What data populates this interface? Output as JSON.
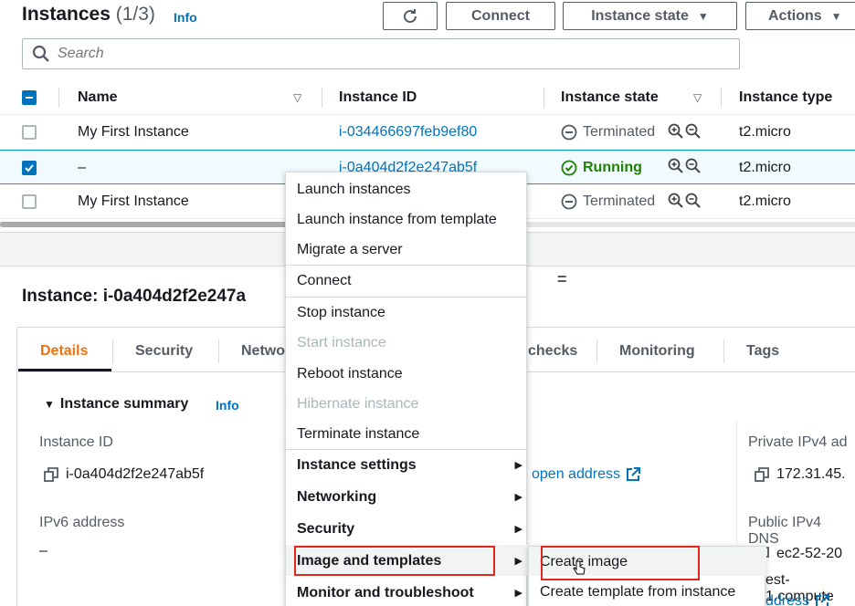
{
  "header": {
    "title": "Instances",
    "count": "(1/3)",
    "info": "Info",
    "connect": "Connect",
    "instance_state": "Instance state",
    "actions": "Actions"
  },
  "search": {
    "placeholder": "Search"
  },
  "table": {
    "columns": [
      "Name",
      "Instance ID",
      "Instance state",
      "Instance type"
    ],
    "rows": [
      {
        "name": "My First Instance",
        "id": "i-034466697feb9ef80",
        "state": "Terminated",
        "type": "t2.micro",
        "selected": false
      },
      {
        "name": "–",
        "id": "i-0a404d2f2e247ab5f",
        "state": "Running",
        "type": "t2.micro",
        "selected": true
      },
      {
        "name": "My First Instance",
        "id": "",
        "state": "Terminated",
        "type": "t2.micro",
        "selected": false
      }
    ]
  },
  "details": {
    "title": "Instance: i-0a404d2f2e247a",
    "tabs": [
      "Details",
      "Security",
      "Netwo",
      "checks",
      "Monitoring",
      "Tags"
    ],
    "summary": "Instance summary",
    "summary_info": "Info",
    "instance_id_label": "Instance ID",
    "instance_id_value": "i-0a404d2f2e247ab5f",
    "ipv6_label": "IPv6 address",
    "ipv6_value": "–",
    "open_address": "open address",
    "private_ipv4_label": "Private IPv4 ad",
    "private_ipv4_value": "172.31.45.",
    "public_dns_label": "Public IPv4 DNS",
    "public_dns_value": "ec2-52-20",
    "public_dns_value2": "est-1.compute",
    "address_link": "ddress"
  },
  "context_menu": {
    "items": [
      {
        "label": "Launch instances"
      },
      {
        "label": "Launch instance from template"
      },
      {
        "label": "Migrate a server"
      },
      {
        "label": "Connect"
      },
      {
        "label": "Stop instance"
      },
      {
        "label": "Start instance"
      },
      {
        "label": "Reboot instance"
      },
      {
        "label": "Hibernate instance"
      },
      {
        "label": "Terminate instance"
      },
      {
        "label": "Instance settings"
      },
      {
        "label": "Networking"
      },
      {
        "label": "Security"
      },
      {
        "label": "Image and templates"
      },
      {
        "label": "Monitor and troubleshoot"
      }
    ]
  },
  "submenu": {
    "items": [
      {
        "label": "Create image"
      },
      {
        "label": "Create template from instance"
      }
    ]
  },
  "colors": {
    "link": "#0073bb",
    "running": "#1d8102",
    "active_tab": "#ec7211",
    "highlight": "#e0271b"
  }
}
